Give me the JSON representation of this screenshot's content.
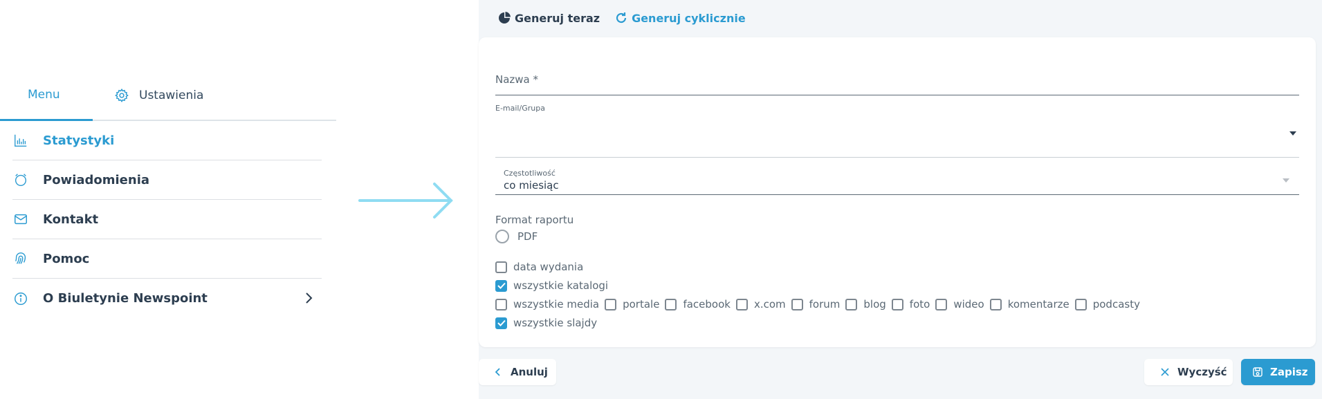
{
  "menu": {
    "tabs": [
      {
        "label": "Menu",
        "active": true
      },
      {
        "label": "Ustawienia",
        "icon": "gear-icon"
      }
    ],
    "items": [
      {
        "label": "Statystyki",
        "icon": "bar-chart-icon",
        "active": true
      },
      {
        "label": "Powiadomienia",
        "icon": "alarm-clock-icon"
      },
      {
        "label": "Kontakt",
        "icon": "envelope-icon"
      },
      {
        "label": "Pomoc",
        "icon": "fingerprint-icon"
      },
      {
        "label": "O Biuletynie Newspoint",
        "icon": "info-icon",
        "chevron": "chevron-right-icon"
      }
    ]
  },
  "form": {
    "tabs": [
      {
        "label": "Generuj teraz",
        "icon": "pie-chart-icon"
      },
      {
        "label": "Generuj cyklicznie",
        "icon": "refresh-icon",
        "active": true
      }
    ],
    "name_label": "Nazwa *",
    "email_label": "E-mail/Grupa",
    "frequency_label": "Częstotliwość",
    "frequency_value": "co miesiąc",
    "format_label": "Format raportu",
    "format_option": "PDF",
    "checkboxes": {
      "date": {
        "label": "data wydania",
        "checked": false
      },
      "catalogs": {
        "label": "wszystkie katalogi",
        "checked": true
      },
      "media": [
        {
          "label": "wszystkie media",
          "checked": false
        },
        {
          "label": "portale",
          "checked": false
        },
        {
          "label": "facebook",
          "checked": false
        },
        {
          "label": "x.com",
          "checked": false
        },
        {
          "label": "forum",
          "checked": false
        },
        {
          "label": "blog",
          "checked": false
        },
        {
          "label": "foto",
          "checked": false
        },
        {
          "label": "wideo",
          "checked": false
        },
        {
          "label": "komentarze",
          "checked": false
        },
        {
          "label": "podcasty",
          "checked": false
        }
      ],
      "slides": {
        "label": "wszystkie slajdy",
        "checked": true
      }
    },
    "buttons": {
      "cancel": "Anuluj",
      "clear": "Wyczyść",
      "save": "Zapisz"
    }
  },
  "colors": {
    "accent": "#2b9bd1",
    "text": "#2d3e50",
    "muted": "#5a6874",
    "background": "#f3f6f9",
    "arrow": "#8fdcf2"
  }
}
